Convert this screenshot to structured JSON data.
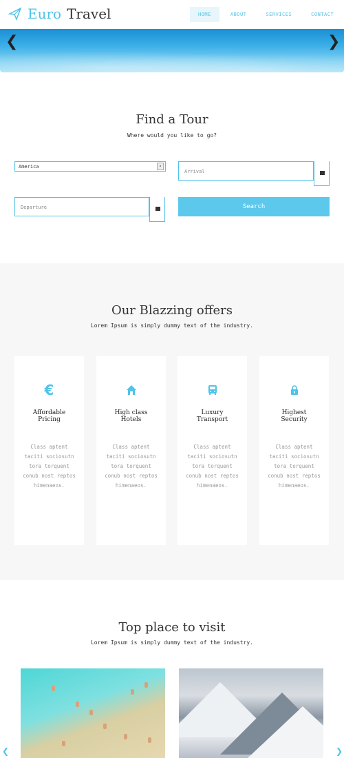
{
  "header": {
    "logo_part1": "Euro",
    "logo_part2": "Travel",
    "nav": [
      {
        "label": "HOME",
        "active": true
      },
      {
        "label": "ABOUT",
        "active": false
      },
      {
        "label": "SERVICES",
        "active": false
      },
      {
        "label": "CONTACT",
        "active": false
      }
    ]
  },
  "hero": {
    "prev_icon": "chevron-left-icon",
    "next_icon": "chevron-right-icon"
  },
  "find_tour": {
    "title": "Find a Tour",
    "subtitle": "Where would you like to go?",
    "destination_value": "America",
    "arrival_placeholder": "Arrival",
    "departure_placeholder": "Departure",
    "search_label": "Search"
  },
  "offers": {
    "title": "Our Blazzing offers",
    "subtitle": "Lorem Ipsum is simply dummy text of the industry.",
    "cards": [
      {
        "icon": "euro-icon",
        "title_line1": "Affordable",
        "title_line2": "Pricing",
        "text": "Class aptent taciti sociosutn tora torquent conub nost reptos himenaeos."
      },
      {
        "icon": "home-icon",
        "title_line1": "High class",
        "title_line2": "Hotels",
        "text": "Class aptent taciti sociosutn tora torquent conub nost reptos himenaeos."
      },
      {
        "icon": "bus-icon",
        "title_line1": "Luxury",
        "title_line2": "Transport",
        "text": "Class aptent taciti sociosutn tora torquent conub nost reptos himenaeos."
      },
      {
        "icon": "lock-icon",
        "title_line1": "Highest",
        "title_line2": "Security",
        "text": "Class aptent taciti sociosutn tora torquent conub nost reptos himenaeos."
      }
    ]
  },
  "places": {
    "title": "Top place to visit",
    "subtitle": "Lorem Ipsum is simply dummy text of the industry."
  },
  "colors": {
    "accent": "#4fc3e8",
    "button": "#5cc8ec",
    "offers_bg": "#f7f7f7"
  }
}
